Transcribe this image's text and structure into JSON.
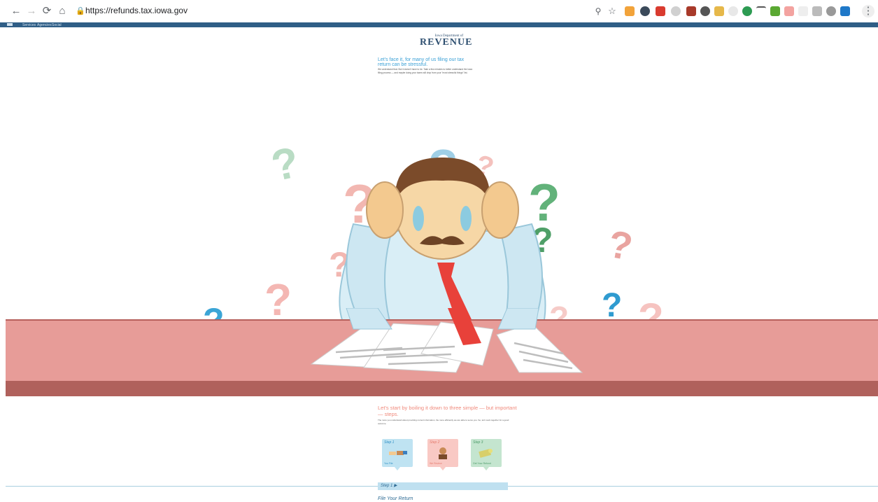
{
  "browser": {
    "url": "https://refunds.tax.iowa.gov"
  },
  "site_nav": {
    "items": [
      "Services",
      "Agencies",
      "Social"
    ]
  },
  "logo": {
    "line1": "Iowa Department of",
    "line2": "REVENUE"
  },
  "intro": {
    "heading": "Let's face it, for many of us filing our tax return can be stressful.",
    "body": "We understand that. But it doesn't have to be. Take a few minutes to better understand the Iowa filing process — and maybe doing your taxes will drop from your \"most stressful things\" list."
  },
  "steps_section": {
    "heading": "Let's start by boiling it down to three simple — but important — steps.",
    "body": "The more you understand about providing correct information, the more efficiently we are able to serve you. So, let's work together for a good outcome.",
    "cards": [
      {
        "label": "Step 1",
        "caption": "You File",
        "color": "#bfe3f2",
        "text_color": "#2f8fc4"
      },
      {
        "label": "Step 2",
        "caption": "We Review",
        "color": "#f9c9c4",
        "text_color": "#e47b6e"
      },
      {
        "label": "Step 3",
        "caption": "Get Your Refund",
        "color": "#c4e5cf",
        "text_color": "#4c9a68"
      }
    ]
  },
  "step_bar": {
    "label": "Step 1 ▶"
  },
  "file_return": {
    "title": "File Your Return"
  },
  "colors": {
    "table_top": "#e79c98",
    "table_front": "#b0615c",
    "accent_blue": "#3aa0d6",
    "accent_red": "#f08a7c"
  }
}
